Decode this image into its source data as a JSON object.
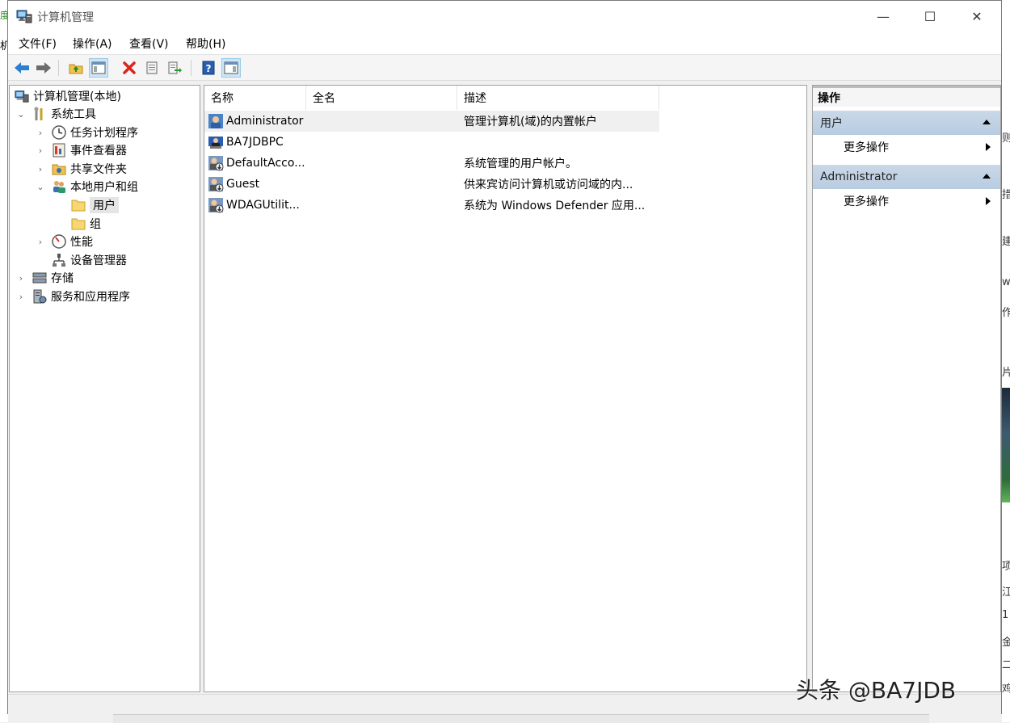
{
  "window": {
    "title": "计算机管理"
  },
  "titlebar_buttons": {
    "minimize": "—",
    "maximize": "☐",
    "close": "✕"
  },
  "menu": [
    "文件(F)",
    "操作(A)",
    "查看(V)",
    "帮助(H)"
  ],
  "toolbar": {
    "icons": [
      "back-icon",
      "forward-icon",
      "up-folder-icon",
      "show-hide-tree-icon",
      "delete-icon",
      "properties-icon",
      "export-list-icon",
      "help-icon",
      "show-hide-action-pane-icon"
    ]
  },
  "tree": [
    {
      "label": "计算机管理(本地)",
      "icon": "computer-management-icon",
      "expander": ""
    },
    {
      "label": "系统工具",
      "icon": "system-tools-icon",
      "expander": "⌄"
    },
    {
      "label": "任务计划程序",
      "icon": "clock-icon",
      "expander": "›"
    },
    {
      "label": "事件查看器",
      "icon": "event-viewer-icon",
      "expander": "›"
    },
    {
      "label": "共享文件夹",
      "icon": "shared-folder-icon",
      "expander": "›"
    },
    {
      "label": "本地用户和组",
      "icon": "local-users-groups-icon",
      "expander": "⌄"
    },
    {
      "label": "用户",
      "icon": "folder-icon",
      "expander": "",
      "selected": true
    },
    {
      "label": "组",
      "icon": "folder-icon",
      "expander": ""
    },
    {
      "label": "性能",
      "icon": "performance-icon",
      "expander": "›"
    },
    {
      "label": "设备管理器",
      "icon": "device-manager-icon",
      "expander": ""
    },
    {
      "label": "存储",
      "icon": "storage-icon",
      "expander": "›"
    },
    {
      "label": "服务和应用程序",
      "icon": "services-apps-icon",
      "expander": "›"
    }
  ],
  "list": {
    "columns": [
      "名称",
      "全名",
      "描述"
    ],
    "rows": [
      {
        "name": "Administrator",
        "fullname": "",
        "description": "管理计算机(域)的内置帐户",
        "icon": "user-icon",
        "selected": true
      },
      {
        "name": "BA7JDBPC",
        "fullname": "",
        "description": "",
        "icon": "user-icon"
      },
      {
        "name": "DefaultAcco...",
        "fullname": "",
        "description": "系统管理的用户帐户。",
        "icon": "disabled-user-icon"
      },
      {
        "name": "Guest",
        "fullname": "",
        "description": "供来宾访问计算机或访问域的内...",
        "icon": "disabled-user-icon"
      },
      {
        "name": "WDAGUtilit...",
        "fullname": "",
        "description": "系统为 Windows Defender 应用...",
        "icon": "disabled-user-icon"
      }
    ]
  },
  "actions": {
    "header": "操作",
    "sections": [
      {
        "title": "用户",
        "items": [
          "更多操作"
        ]
      },
      {
        "title": "Administrator",
        "items": [
          "更多操作"
        ]
      }
    ]
  },
  "watermark": "头条 @BA7JDB",
  "background_peek": {
    "left": [
      "度",
      "机"
    ],
    "right": [
      "则",
      "措",
      "建",
      "ws",
      "作",
      "片",
      "项",
      "江",
      "1",
      "金",
      "二",
      "鸡"
    ]
  },
  "colors": {
    "section_bg": "#c4d4e6",
    "selection": "#e5e5e5",
    "toolbar_active": "#cde6f7"
  }
}
